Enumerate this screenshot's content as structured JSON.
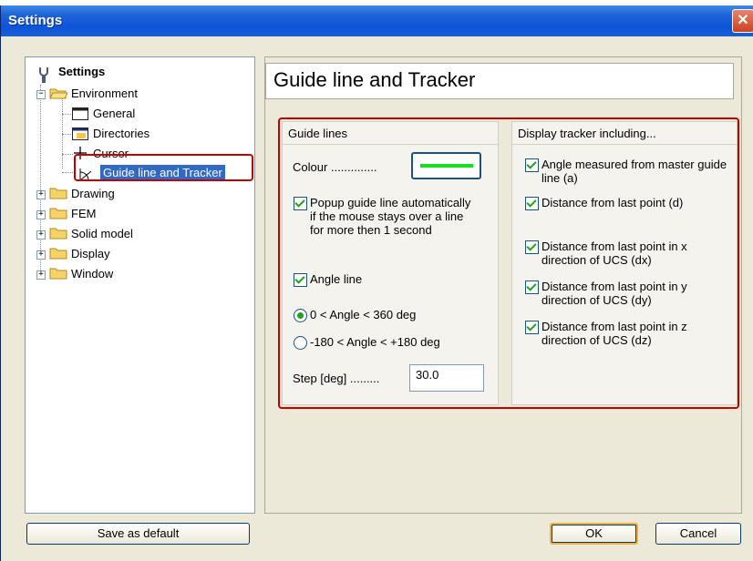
{
  "window": {
    "title": "Settings",
    "close_glyph": "✕"
  },
  "tree": {
    "root_label": "Settings",
    "items": [
      {
        "label": "Environment",
        "icon": "folder-open-icon"
      },
      {
        "label": "General",
        "icon": "window-icon"
      },
      {
        "label": "Directories",
        "icon": "directories-icon"
      },
      {
        "label": "Cursor",
        "icon": "crosshair-icon"
      },
      {
        "label": "Guide line and Tracker",
        "icon": "protractor-icon",
        "selected": true
      },
      {
        "label": "Drawing",
        "icon": "folder-icon"
      },
      {
        "label": "FEM",
        "icon": "folder-icon"
      },
      {
        "label": "Solid model",
        "icon": "folder-icon"
      },
      {
        "label": "Display",
        "icon": "folder-icon"
      },
      {
        "label": "Window",
        "icon": "folder-icon"
      }
    ]
  },
  "panel": {
    "heading": "Guide line and Tracker",
    "guide_lines": {
      "title": "Guide lines",
      "colour_label": "Colour ..............",
      "colour_value": "#19e01c",
      "popup_checked": true,
      "popup_label": "Popup guide line automatically if the mouse stays over a line for more then 1 second",
      "angle_line_checked": true,
      "angle_line_label": "Angle line",
      "radio_options": [
        "0 < Angle < 360 deg",
        "-180 < Angle < +180 deg"
      ],
      "radio_selected": 0,
      "step_label": "Step [deg] .........",
      "step_value": "30.0"
    },
    "tracker": {
      "title": "Display tracker including...",
      "items": [
        {
          "label": "Angle measured from master guide line (a)",
          "checked": true
        },
        {
          "label": "Distance from last point (d)",
          "checked": true
        },
        {
          "label": "Distance from last point in x direction of UCS (dx)",
          "checked": true
        },
        {
          "label": "Distance from last point in y direction of UCS (dy)",
          "checked": true
        },
        {
          "label": "Distance from last point in z direction of UCS (dz)",
          "checked": true
        }
      ]
    }
  },
  "buttons": {
    "save_default": "Save as default",
    "ok": "OK",
    "cancel": "Cancel"
  },
  "colors": {
    "highlight": "#c00000",
    "selection": "#316ac5",
    "title_bar": "#0c54d8"
  }
}
